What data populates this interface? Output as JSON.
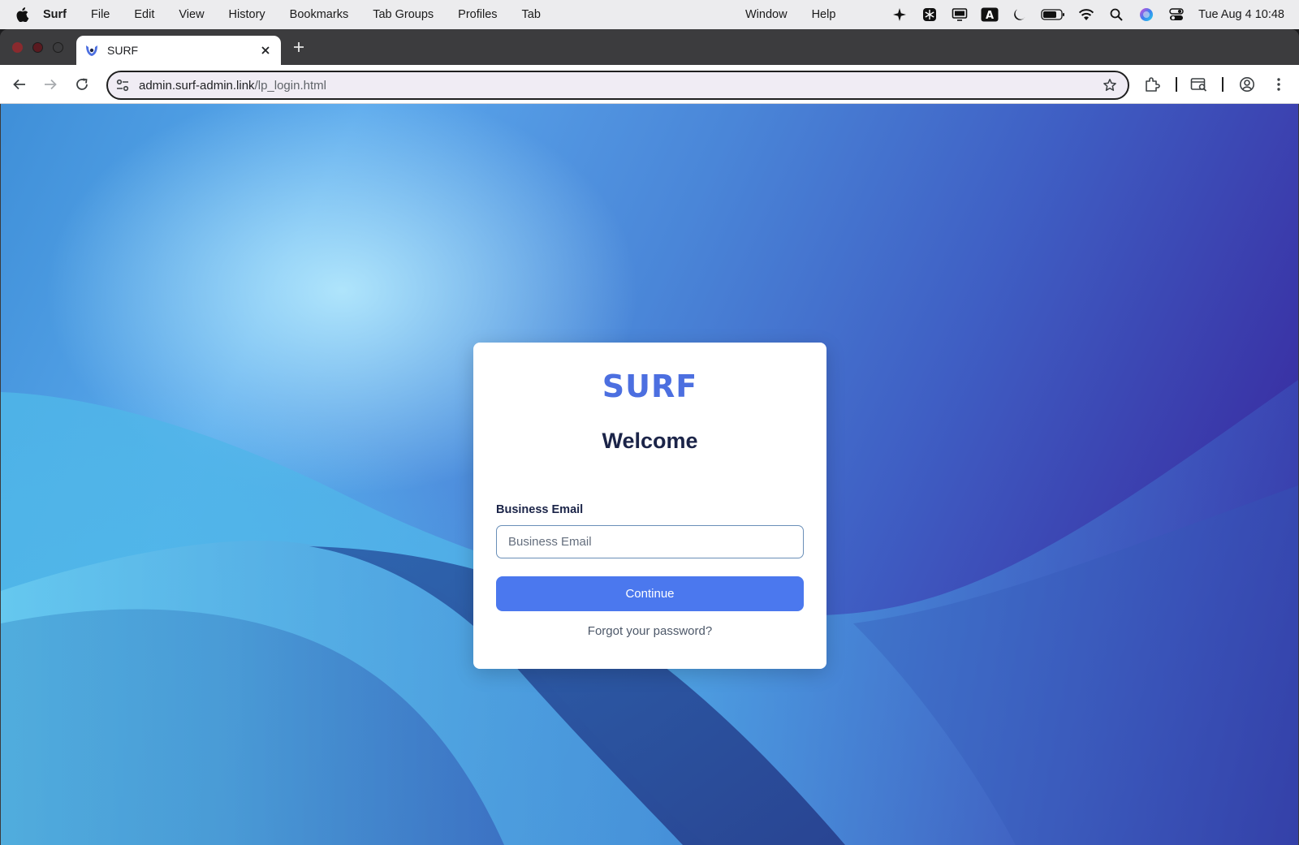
{
  "menubar": {
    "app_name": "Surf",
    "items": [
      "File",
      "Edit",
      "View",
      "History",
      "Bookmarks",
      "Tab Groups",
      "Profiles",
      "Tab"
    ],
    "right_items": [
      "Window",
      "Help"
    ],
    "clock": "Tue Aug 4  10:48",
    "status_icons": [
      "sparkle-icon",
      "snowflake-icon",
      "display-icon",
      "text-input-icon",
      "moon-icon",
      "battery-icon",
      "wifi-icon",
      "search-icon",
      "siri-icon",
      "control-center-icon"
    ]
  },
  "browser": {
    "tab_title": "SURF",
    "url_host": "admin.surf-admin.link",
    "url_path": "/lp_login.html"
  },
  "login": {
    "logo_text": "SURF",
    "heading": "Welcome",
    "email_label": "Business Email",
    "email_placeholder": "Business Email",
    "email_value": "",
    "continue_label": "Continue",
    "forgot_label": "Forgot your password?"
  },
  "colors": {
    "accent": "#4b78ee",
    "logo": "#4c6fe0",
    "heading": "#1b2448"
  }
}
